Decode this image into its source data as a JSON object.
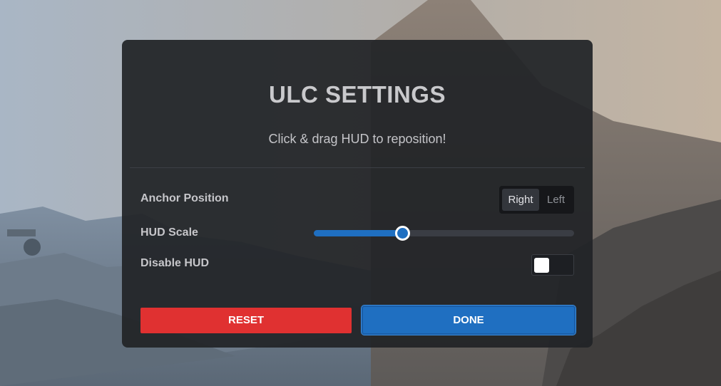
{
  "panel": {
    "title": "ULC SETTINGS",
    "subtitle": "Click & drag HUD to reposition!"
  },
  "anchor_position": {
    "label": "Anchor Position",
    "options": [
      "Right",
      "Left"
    ],
    "selected": "Right"
  },
  "hud_scale": {
    "label": "HUD Scale",
    "value_fraction": 0.34
  },
  "disable_hud": {
    "label": "Disable HUD",
    "enabled": false
  },
  "buttons": {
    "reset_label": "RESET",
    "done_label": "DONE"
  },
  "colors": {
    "accent": "#1f6fc1",
    "danger": "#e03131",
    "panel_bg": "#212327"
  }
}
